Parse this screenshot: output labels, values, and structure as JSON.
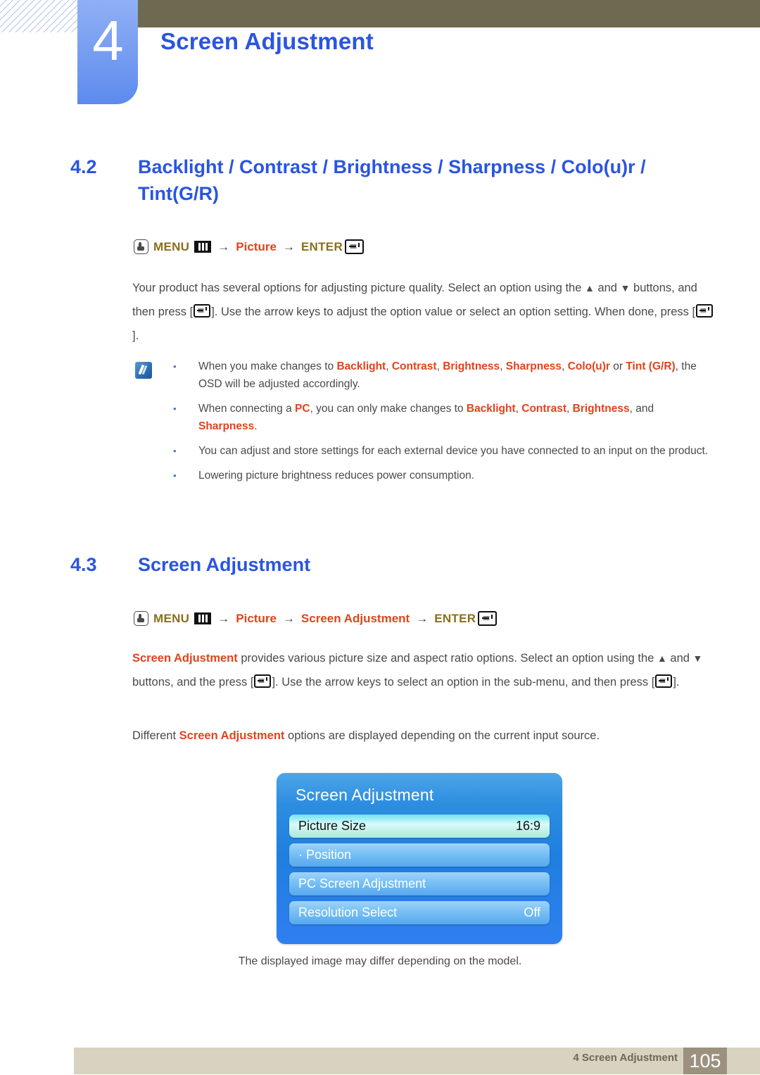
{
  "header": {
    "chapter_number": "4",
    "chapter_title": "Screen Adjustment"
  },
  "sections": [
    {
      "number": "4.2",
      "title": "Backlight / Contrast / Brightness / Sharpness / Colo(u)r / Tint(G/R)",
      "menu_path": {
        "press_icon": "hand-press-icon",
        "menu_label": "MENU",
        "menu_icon": "menu-bars-icon",
        "arrow": "→",
        "target": "Picture",
        "enter_label": "ENTER",
        "enter_icon": "enter-key-icon"
      }
    },
    {
      "number": "4.3",
      "title": "Screen Adjustment",
      "menu_path": {
        "press_icon": "hand-press-icon",
        "menu_label": "MENU",
        "menu_icon": "menu-bars-icon",
        "arrow": "→",
        "target": "Picture",
        "target2": "Screen Adjustment",
        "enter_label": "ENTER",
        "enter_icon": "enter-key-icon"
      }
    }
  ],
  "body": {
    "para1_a": "Your product has several options for adjusting picture quality. Select an option using the",
    "para1_up": "▲",
    "para1_b": "and",
    "para1_down": "▼",
    "para1_c": "buttons, and then press [",
    "para1_d": "]. Use the arrow keys to adjust the option value or select an option setting. When done, press [",
    "para1_e": "].",
    "para2_hl": "Screen Adjustment",
    "para2_a": "provides various picture size and aspect ratio options. Select an option using the",
    "para2_up": "▲",
    "para2_b": "and",
    "para2_down": "▼",
    "para2_c": "buttons, and the press [",
    "para2_d": "]. Use the arrow keys to select an option in the sub-menu, and then press [",
    "para2_e": "].",
    "para3_a": "Different",
    "para3_hl": "Screen Adjustment",
    "para3_b": "options are displayed depending on the current input source."
  },
  "notes": {
    "icon": "note-pencil-icon",
    "items": [
      {
        "segments": [
          {
            "text": "When you make changes to ",
            "highlight": false
          },
          {
            "text": "Backlight",
            "highlight": true
          },
          {
            "text": ", ",
            "highlight": false
          },
          {
            "text": "Contrast",
            "highlight": true
          },
          {
            "text": ", ",
            "highlight": false
          },
          {
            "text": "Brightness",
            "highlight": true
          },
          {
            "text": ", ",
            "highlight": false
          },
          {
            "text": "Sharpness",
            "highlight": true
          },
          {
            "text": ", ",
            "highlight": false
          },
          {
            "text": "Colo(u)r",
            "highlight": true
          },
          {
            "text": " or ",
            "highlight": false
          },
          {
            "text": "Tint (G/R)",
            "highlight": true
          },
          {
            "text": ", the OSD will be adjusted accordingly.",
            "highlight": false
          }
        ]
      },
      {
        "segments": [
          {
            "text": "When connecting a ",
            "highlight": false
          },
          {
            "text": "PC",
            "highlight": true
          },
          {
            "text": ", you can only make changes to ",
            "highlight": false
          },
          {
            "text": "Backlight",
            "highlight": true
          },
          {
            "text": ", ",
            "highlight": false
          },
          {
            "text": "Contrast",
            "highlight": true
          },
          {
            "text": ", ",
            "highlight": false
          },
          {
            "text": "Brightness",
            "highlight": true
          },
          {
            "text": ", and ",
            "highlight": false
          },
          {
            "text": "Sharpness",
            "highlight": true
          },
          {
            "text": ".",
            "highlight": false
          }
        ]
      },
      {
        "segments": [
          {
            "text": "You can adjust and store settings for each external device you have connected to an input on the product.",
            "highlight": false
          }
        ]
      },
      {
        "segments": [
          {
            "text": "Lowering picture brightness reduces power consumption.",
            "highlight": false
          }
        ]
      }
    ]
  },
  "osd": {
    "title": "Screen Adjustment",
    "rows": [
      {
        "label": "Picture Size",
        "value": "16:9",
        "selected": true
      },
      {
        "label": "· Position",
        "value": "",
        "selected": false
      },
      {
        "label": "PC Screen Adjustment",
        "value": "",
        "selected": false
      },
      {
        "label": "Resolution Select",
        "value": "Off",
        "selected": false
      }
    ],
    "caption": "The displayed image may differ depending on the model."
  },
  "footer": {
    "text": "4 Screen Adjustment",
    "page": "105"
  },
  "colors": {
    "heading_blue": "#2a55e0",
    "olive_bar": "#6e6a52",
    "menu_olive": "#8a6f1c",
    "highlight_red": "#e1431b",
    "footer_beige": "#d8d3c0",
    "footer_page_box": "#9b917e",
    "osd_blue": "#1f7fe0"
  }
}
